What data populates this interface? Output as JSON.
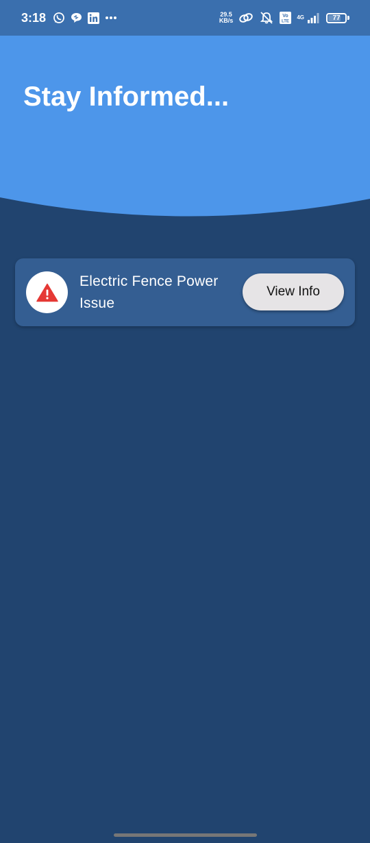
{
  "status_bar": {
    "time": "3:18",
    "left_icons": [
      "whatsapp-icon",
      "chat-bubble-icon",
      "linkedin-icon",
      "more-dots-icon"
    ],
    "net_speed_value": "29.5",
    "net_speed_unit": "KB/s",
    "network_type": "4G",
    "volte_top": "Vo",
    "volte_bottom": "LTE",
    "battery_level": "77",
    "battery_percent": 77
  },
  "header": {
    "title": "Stay Informed...",
    "background_color": "#4d96ea"
  },
  "notifications": [
    {
      "title": "Electric Fence Power Issue",
      "icon": "warning-triangle-icon",
      "icon_color": "#e53935",
      "button_label": "View Info"
    }
  ],
  "theme": {
    "page_background": "#21446f",
    "card_background": "#345e92",
    "button_background": "#e6e4e6"
  }
}
